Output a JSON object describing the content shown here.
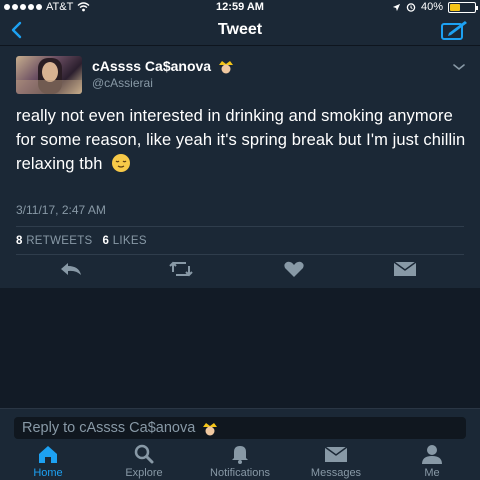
{
  "status_bar": {
    "carrier": "AT&T",
    "time": "12:59 AM",
    "battery": "40%",
    "battery_level": 0.4
  },
  "nav": {
    "title": "Tweet",
    "back_icon": "chevron-left-icon",
    "compose_icon": "compose-tweet-icon"
  },
  "tweet": {
    "author_name": "cAssss Ca$anova",
    "author_handle": "@cAssierai",
    "text": "really not even interested in drinking and smoking anymore for some reason, like yeah it's spring break but I'm just chillin relaxing tbh",
    "timestamp": "3/11/17, 2:47 AM",
    "retweets_count": "8",
    "retweets_label": "RETWEETS",
    "likes_count": "6",
    "likes_label": "LIKES"
  },
  "actions": [
    "reply-icon",
    "retweet-icon",
    "like-icon",
    "direct-message-icon"
  ],
  "reply": {
    "placeholder": "Reply to cAssss Ca$anova"
  },
  "tabs": [
    {
      "label": "Home",
      "icon": "home-icon",
      "active": true
    },
    {
      "label": "Explore",
      "icon": "search-icon",
      "active": false
    },
    {
      "label": "Notifications",
      "icon": "bell-icon",
      "active": false
    },
    {
      "label": "Messages",
      "icon": "envelope-icon",
      "active": false
    },
    {
      "label": "Me",
      "icon": "person-icon",
      "active": false
    }
  ],
  "colors": {
    "accent": "#1da1f2",
    "background": "#1b2836",
    "secondary_text": "#8899a6",
    "battery": "#f5c518"
  }
}
